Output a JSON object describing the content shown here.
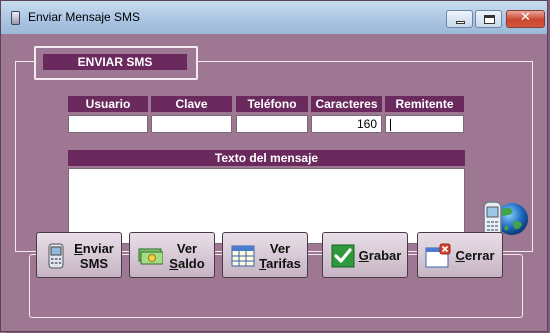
{
  "window": {
    "title": "Enviar Mensaje SMS",
    "minimize_icon": "minimize-icon",
    "maximize_icon": "maximize-icon",
    "close_icon": "close-icon",
    "close_glyph": "✕"
  },
  "group": {
    "caption": "ENVIAR SMS"
  },
  "fields": {
    "usuario": {
      "label": "Usuario",
      "value": ""
    },
    "clave": {
      "label": "Clave",
      "value": ""
    },
    "telefono": {
      "label": "Teléfono",
      "value": ""
    },
    "caracteres": {
      "label": "Caracteres",
      "value": "160"
    },
    "remitente": {
      "label": "Remitente",
      "value": ""
    }
  },
  "message": {
    "label": "Texto del mensaje",
    "value": ""
  },
  "buttons": {
    "enviar": {
      "line1_u": "E",
      "line1": "nviar",
      "line2": "SMS",
      "icon": "phone-icon"
    },
    "ver_saldo": {
      "line1": "Ver",
      "line2_u": "S",
      "line2": "aldo",
      "icon": "money-icon"
    },
    "ver_tarifas": {
      "line1": "Ver",
      "line2_u": "T",
      "line2": "arifas",
      "icon": "table-icon"
    },
    "grabar": {
      "label_u": "G",
      "label": "rabar",
      "icon": "checkmark-icon"
    },
    "cerrar": {
      "label_u": "C",
      "label": "errar",
      "icon": "close-window-icon"
    }
  },
  "decor": {
    "illustration": "mobile-phone-globe-icon"
  },
  "colors": {
    "header_bg": "#6b2a5e",
    "window_bg": "#9e7893",
    "titlebar": "#a9c4e2",
    "close_btn": "#c9452f"
  }
}
